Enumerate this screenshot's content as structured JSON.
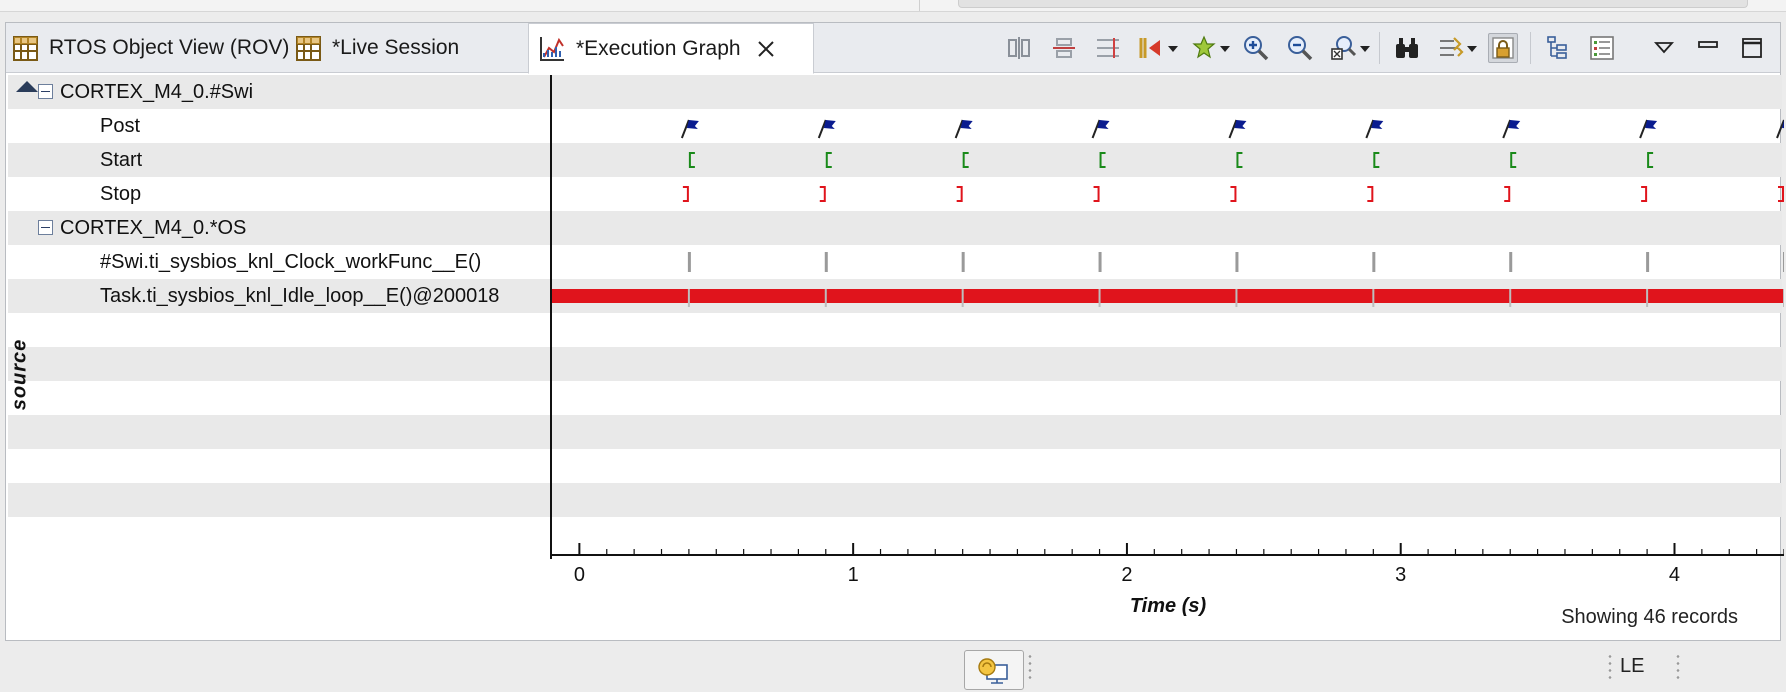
{
  "tabs": [
    {
      "label": "RTOS Object View (ROV)",
      "icon": "table-icon",
      "active": false
    },
    {
      "label": "*Live Session",
      "icon": "table-icon",
      "active": false
    },
    {
      "label": "*Execution Graph",
      "icon": "graph-icon",
      "active": true
    }
  ],
  "toolbar": {
    "buttons": [
      "align-icon",
      "group-icon",
      "measure-icon",
      "prev-event-icon",
      "highlight-icon",
      "zoom-in-icon",
      "zoom-out-icon",
      "zoom-fit-icon",
      "find-icon",
      "filter-icon",
      "lock-icon",
      "tree-icon",
      "list-icon"
    ],
    "view_menu": "view-menu-icon",
    "minimize": "minimize-icon",
    "maximize": "maximize-icon"
  },
  "rows": {
    "group1": "CORTEX_M4_0.#Swi",
    "post": "Post",
    "start": "Start",
    "stop": "Stop",
    "group2": "CORTEX_M4_0.*OS",
    "swi_func": "#Swi.ti_sysbios_knl_Clock_workFunc__E()",
    "task_idle": "Task.ti_sysbios_knl_Idle_loop__E()@200018"
  },
  "source_axis_label": "source",
  "colors": {
    "flag": "#0a1c8f",
    "start": "#1a8a1a",
    "stop": "#e0141c",
    "task_bar": "#e0141c",
    "swi_tick": "#9a9a9a"
  },
  "chart_data": {
    "type": "timeline",
    "x": [
      0.4,
      0.9,
      1.4,
      1.9,
      2.4,
      2.9,
      3.4,
      3.9,
      4.4
    ],
    "xlabel": "Time  (s)",
    "xticks": [
      "0",
      "1",
      "2",
      "3",
      "4"
    ],
    "xlim": [
      -0.1,
      4.4
    ],
    "task_span": [
      -0.1,
      4.4
    ]
  },
  "status": "Showing 46 records",
  "bottom": {
    "le": "LE"
  }
}
